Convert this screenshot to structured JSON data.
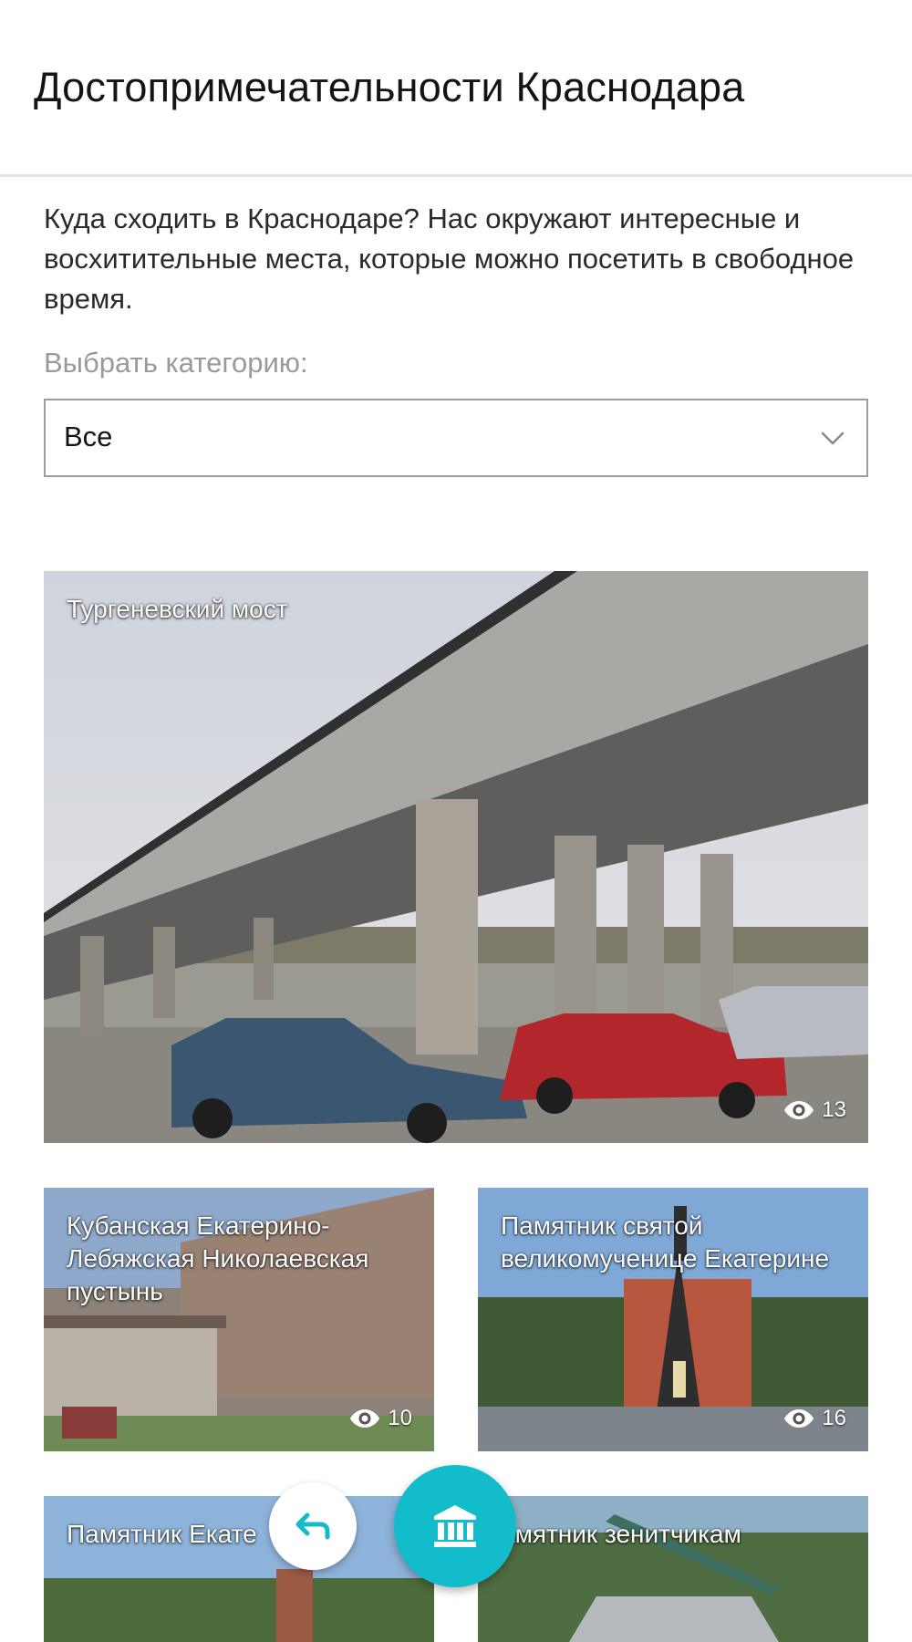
{
  "header": {
    "title": "Достопримечательности Краснодара"
  },
  "intro": {
    "text": "Куда сходить в Краснодаре? Нас окружают интересные и восхитительные места, которые можно посетить в свободное время."
  },
  "category": {
    "label": "Выбрать категорию:",
    "selected": "Все"
  },
  "cards": [
    {
      "title": "Тургеневский мост",
      "views": "13"
    },
    {
      "title": "Кубанская Екатерино-Лебяжская Николаевская пустынь",
      "views": "10"
    },
    {
      "title": "Памятник святой великомученице Екатерине",
      "views": "16"
    },
    {
      "title": "Памятник Екате",
      "views": ""
    },
    {
      "title": "амятник зенитчикам",
      "views": ""
    }
  ],
  "icons": {
    "select": "chevron-down-icon",
    "views": "eye-icon",
    "back": "back-arrow-icon",
    "main": "museum-icon"
  },
  "colors": {
    "accent": "#13bccb",
    "header_divider": "#e4e4e4",
    "label_gray": "#9a9a9a"
  }
}
